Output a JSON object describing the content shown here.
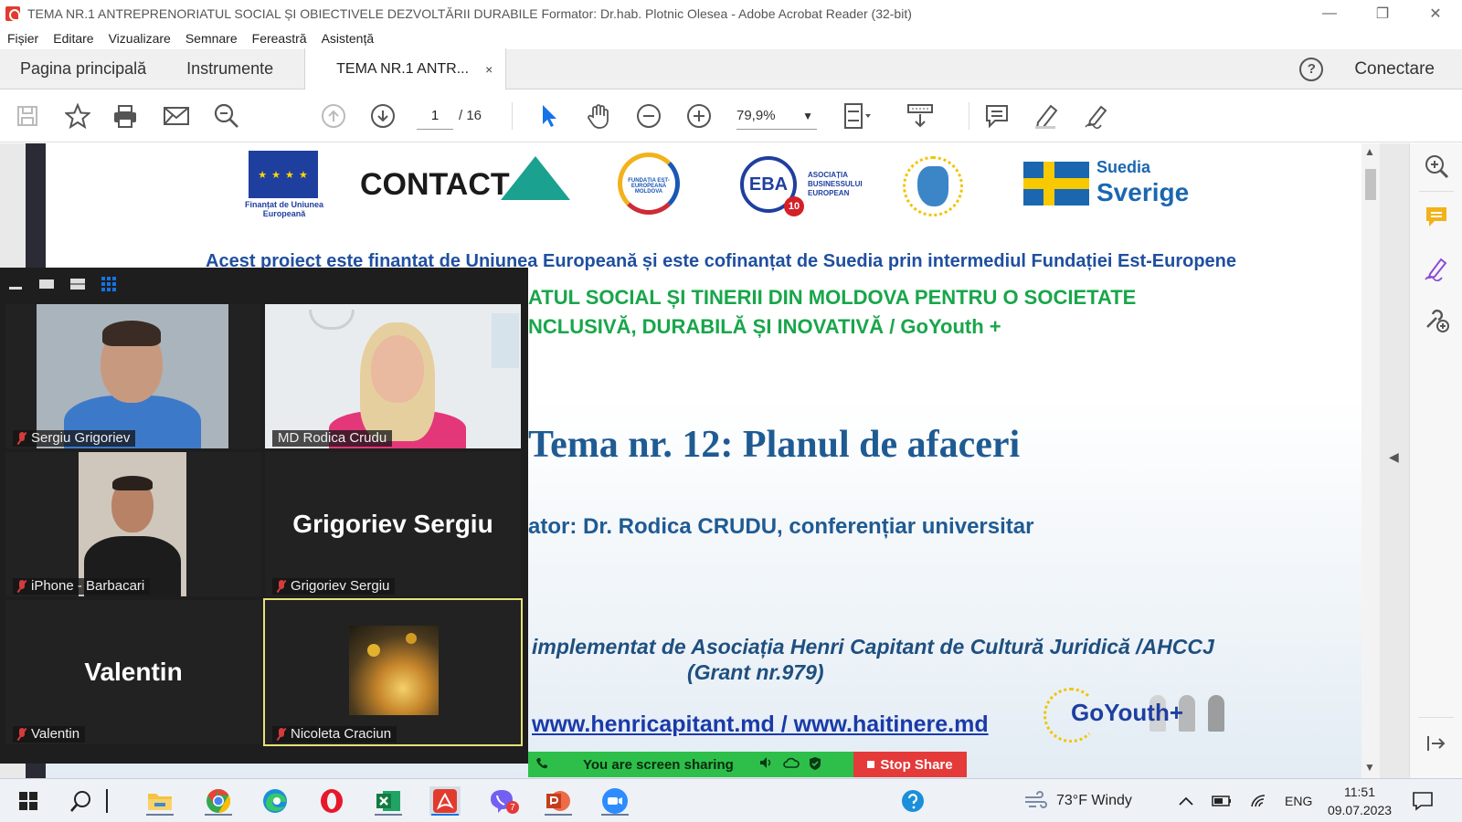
{
  "window": {
    "title": "TEMA NR.1  ANTREPRENORIATUL SOCIAL ȘI OBIECTIVELE DEZVOLTĂRII DURABILE Formator: Dr.hab. Plotnic Olesea - Adobe Acrobat Reader (32-bit)"
  },
  "menu": [
    "Fișier",
    "Editare",
    "Vizualizare",
    "Semnare",
    "Fereastră",
    "Asistență"
  ],
  "tabs": {
    "home": "Pagina principală",
    "tools": "Instrumente",
    "document": "TEMA NR.1  ANTR...",
    "close": "×",
    "help": "?",
    "connect": "Conectare"
  },
  "toolbar": {
    "current_page": "1",
    "total_pages": "/  16",
    "zoom": "79,9%"
  },
  "document": {
    "eu_caption": "Finanțat de Uniunea Europeană",
    "contact_logo": "CONTACT",
    "fund_logo": "FUNDAȚIA EST-EUROPEANĂ MOLDOVA",
    "eba_logo": "EBA",
    "eba_badge": "10",
    "eba_text": "ASOCIAȚIA BUSINESSULUI EUROPEAN",
    "suedia": "Suedia",
    "sverige": "Sverige",
    "funding_line": "Acest proiect este finanțat de Uniunea Europeană și este cofinanțat de Suedia prin intermediul Fundației Est-Europene",
    "project_line1": "ATUL SOCIAL ȘI TINERII DIN MOLDOVA  PENTRU O SOCIETATE",
    "project_line2": "NCLUSIVĂ, DURABILĂ ȘI INOVATIVĂ  / GoYouth +",
    "topic": "Tema nr. 12: Planul de afaceri",
    "trainer": "ator: Dr. Rodica CRUDU, conferențiar universitar",
    "implemented_by": "implementat de  Asociația Henri Capitant de Cultură Juridică /AHCCJ",
    "grant": "(Grant nr.979)",
    "urls": "www.henricapitant.md / www.haitinere.md",
    "goyouth_logo": "GoYouth+"
  },
  "zoom_gallery": {
    "participants": [
      {
        "name": "Sergiu Grigoriev",
        "muted": true,
        "video": true
      },
      {
        "name": "MD Rodica Crudu",
        "muted": false,
        "video": true
      },
      {
        "name": "iPhone - Barbacari",
        "muted": true,
        "video": true
      },
      {
        "name": "Grigoriev Sergiu",
        "muted": true,
        "video": false,
        "display_name": "Grigoriev Sergiu"
      },
      {
        "name": "Valentin",
        "muted": true,
        "video": false,
        "display_name": "Valentin"
      },
      {
        "name": "Nicoleta Craciun",
        "muted": true,
        "video": true,
        "speaking": true
      }
    ]
  },
  "share_bar": {
    "status": "You are screen sharing",
    "stop": "Stop Share"
  },
  "taskbar": {
    "weather": "73°F  Windy",
    "viber_badge": "7",
    "language": "ENG",
    "time": "11:51",
    "date": "09.07.2023"
  },
  "colors": {
    "acrobat_red": "#e23b2e",
    "accent_blue": "#1473e6",
    "share_green": "#2dbf4a",
    "stop_red": "#e43a3a",
    "project_green": "#18a64a",
    "title_blue": "#1f5b93"
  }
}
